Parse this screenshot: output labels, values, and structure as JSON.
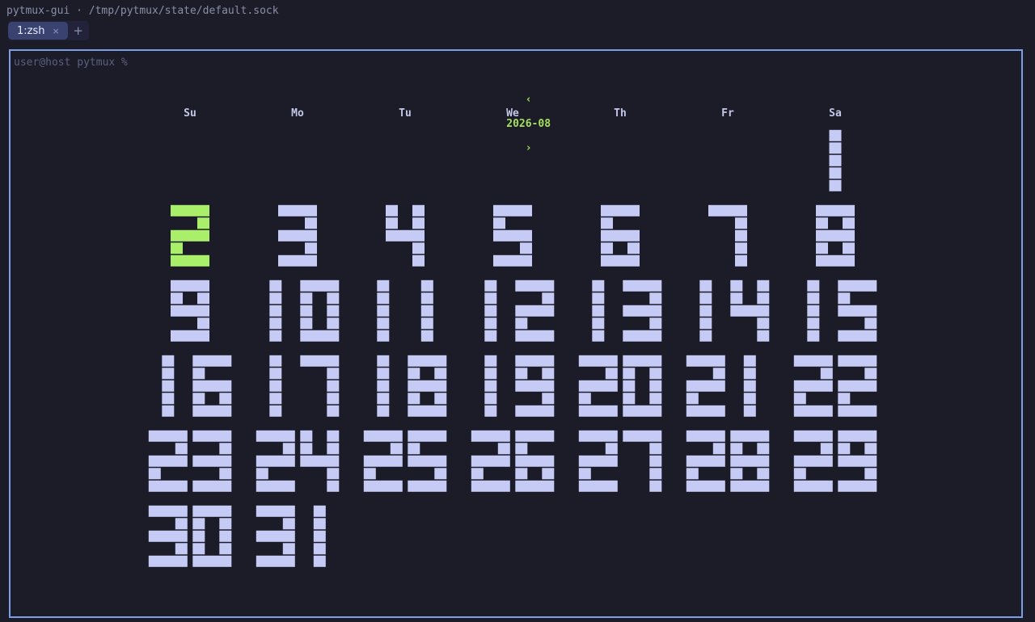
{
  "window": {
    "title": "pytmux-gui · /tmp/pytmux/state/default.sock"
  },
  "tabs": [
    {
      "label": "1:zsh",
      "active": true
    }
  ],
  "tab_close_glyph": "×",
  "new_tab_glyph": "+",
  "terminal": {
    "prompt": "user@host pytmux %"
  },
  "calendar": {
    "prev_glyph": "‹",
    "month": "2026-08",
    "next_glyph": "›",
    "weekdays": [
      "Su",
      "Mo",
      "Tu",
      "We",
      "Th",
      "Fr",
      "Sa"
    ],
    "first_weekday_index": 6,
    "days_in_month": 31,
    "highlighted_day": 2,
    "colors": {
      "day": "#c5cbf5",
      "highlight": "#aaef6a",
      "header": "#a3e05a"
    }
  }
}
